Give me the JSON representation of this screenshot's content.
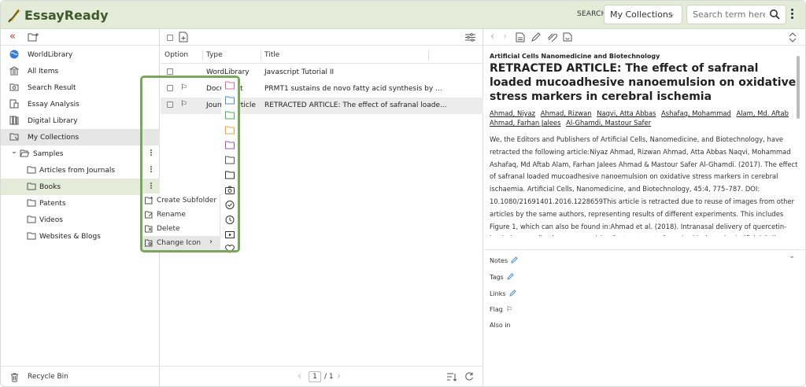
{
  "app": {
    "name": "EssayReady"
  },
  "header": {
    "search_label": "SEARCH",
    "search_scope": "My Collections",
    "search_placeholder": "Search term here"
  },
  "sidebar": {
    "items": [
      {
        "label": "WorldLibrary",
        "icon": "globe-icon"
      },
      {
        "label": "All Items",
        "icon": "library-icon"
      },
      {
        "label": "Search Result",
        "icon": "search-folder-icon"
      },
      {
        "label": "Essay Analysis",
        "icon": "analysis-icon"
      },
      {
        "label": "Digital Library",
        "icon": "books-icon"
      },
      {
        "label": "My Collections",
        "icon": "collections-icon"
      }
    ],
    "tree": {
      "root": "Samples",
      "children": [
        "Articles from Journals",
        "Books",
        "Patents",
        "Videos",
        "Websites & Blogs"
      ]
    },
    "recycle_bin": "Recycle Bin"
  },
  "context_menu": {
    "items": [
      "Create Subfolder",
      "Rename",
      "Delete",
      "Change Icon"
    ]
  },
  "table": {
    "headers": {
      "option": "Option",
      "type": "Type",
      "title": "Title"
    },
    "rows": [
      {
        "type": "WordLibrary",
        "title": "Javascript Tutorial II"
      },
      {
        "type": "Document",
        "title": "PRMT1 sustains de novo fatty acid synthesis by ..."
      },
      {
        "type": "Journal Article",
        "title": "RETRACTED ARTICLE: The effect of safranal loade..."
      }
    ],
    "pager": {
      "current": "1",
      "total": "/ 1"
    }
  },
  "detail": {
    "journal": "Artificial Cells Nanomedicine and Biotechnology",
    "title": "RETRACTED ARTICLE: The effect of safranal loaded mucoadhesive nanoemulsion on oxidative stress markers in cerebral ischemia",
    "authors": [
      "Ahmad, Niyaz",
      "Ahmad, Rizwan",
      "Naqvi, Atta Abbas",
      "Ashafaq, Mohammad",
      "Alam, Md. Aftab",
      "Ahmad, Farhan Jalees",
      "Al-Ghamdi, Mastour Safer"
    ],
    "abstract": "We, the Editors and Publishers of Artificial Cells, Nanomedicine, and Biotechnology, have retracted the following article:Niyaz Ahmad, Rizwan Ahmad, Atta Abbas Naqvi, Mohammad Ashafaq, Md Aftab Alam, Farhan Jalees Ahmad & Mastour Safer Al-Ghamdi. (2017). The effect of safranal loaded mucoadhesive nanoemulsion on oxidative stress markers in cerebral ischaemia. Artificial Cells, Nanomedicine, and Biotechnology, 45:4, 775–787. DOI: 10.1080/21691401.2016.1228659This article is retracted due to reuse of images from other articles by the same authors, representing results of different experiments. This includes Figure 1, which can also be found in:Ahmad et al. (2018). Intranasal delivery of quercetin-loaded mucoadhesive nanoemulsion for treatment of cerebral ischaemia. Artificial Cells, Nanomedicine",
    "meta": {
      "notes": "Notes",
      "tags": "Tags",
      "links": "Links",
      "flag": "Flag",
      "also_in": "Also in"
    }
  },
  "colors": {
    "header_bg": "#e4ebd8",
    "accent": "#79a85d",
    "logo": "#3d5a2a"
  }
}
